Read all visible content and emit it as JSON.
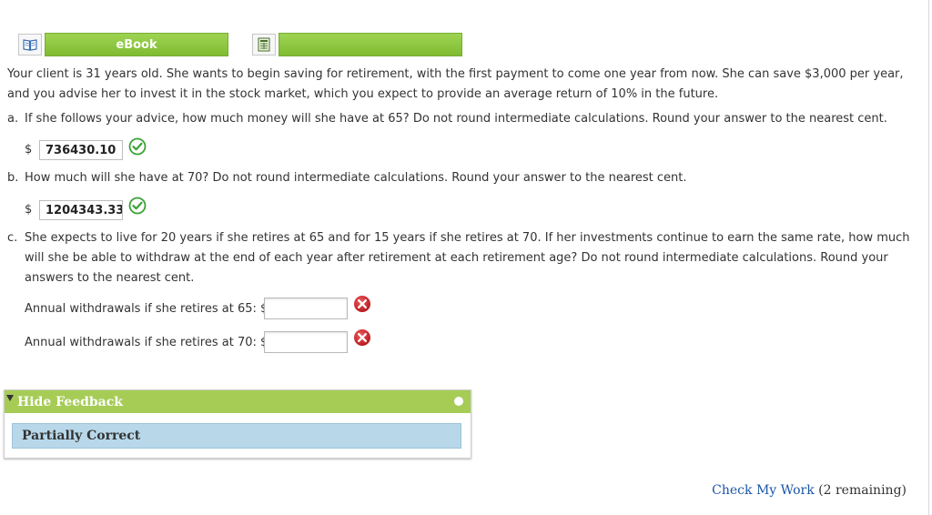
{
  "toolbar": {
    "ebook_label": "eBook"
  },
  "intro": "Your client is 31 years old. She wants to begin saving for retirement, with the first payment to come one year from now. She can save $3,000 per year, and you advise her to invest it in the stock market, which you expect to provide an average return of 10% in the future.",
  "questions": {
    "a": {
      "letter": "a.",
      "text": "If she follows your advice, how much money will she have at 65? Do not round intermediate calculations. Round your answer to the nearest cent.",
      "currency": "$",
      "answer": "736430.10",
      "status": "correct"
    },
    "b": {
      "letter": "b.",
      "text": "How much will she have at 70? Do not round intermediate calculations. Round your answer to the nearest cent.",
      "currency": "$",
      "answer": "1204343.33",
      "status": "correct"
    },
    "c": {
      "letter": "c.",
      "text": "She expects to live for 20 years if she retires at 65 and for 15 years if she retires at 70. If her investments continue to earn the same rate, how much will she be able to withdraw at the end of each year after retirement at each retirement age? Do not round intermediate calculations. Round your answers to the nearest cent.",
      "label_65": "Annual withdrawals if she retires at 65: $",
      "value_65": "",
      "status_65": "incorrect",
      "label_70": "Annual withdrawals if she retires at 70: $",
      "value_70": "",
      "status_70": "incorrect"
    }
  },
  "feedback": {
    "toggle_label": "Hide Feedback",
    "result": "Partially Correct"
  },
  "check_work": {
    "link": "Check My Work",
    "remaining": "(2 remaining)"
  },
  "colors": {
    "green": "#8dc63f",
    "correct": "#3aa335",
    "incorrect": "#cc2229",
    "feedback_head": "#a6cc56",
    "feedback_body": "#b8d8ea",
    "link": "#1a56a8"
  }
}
